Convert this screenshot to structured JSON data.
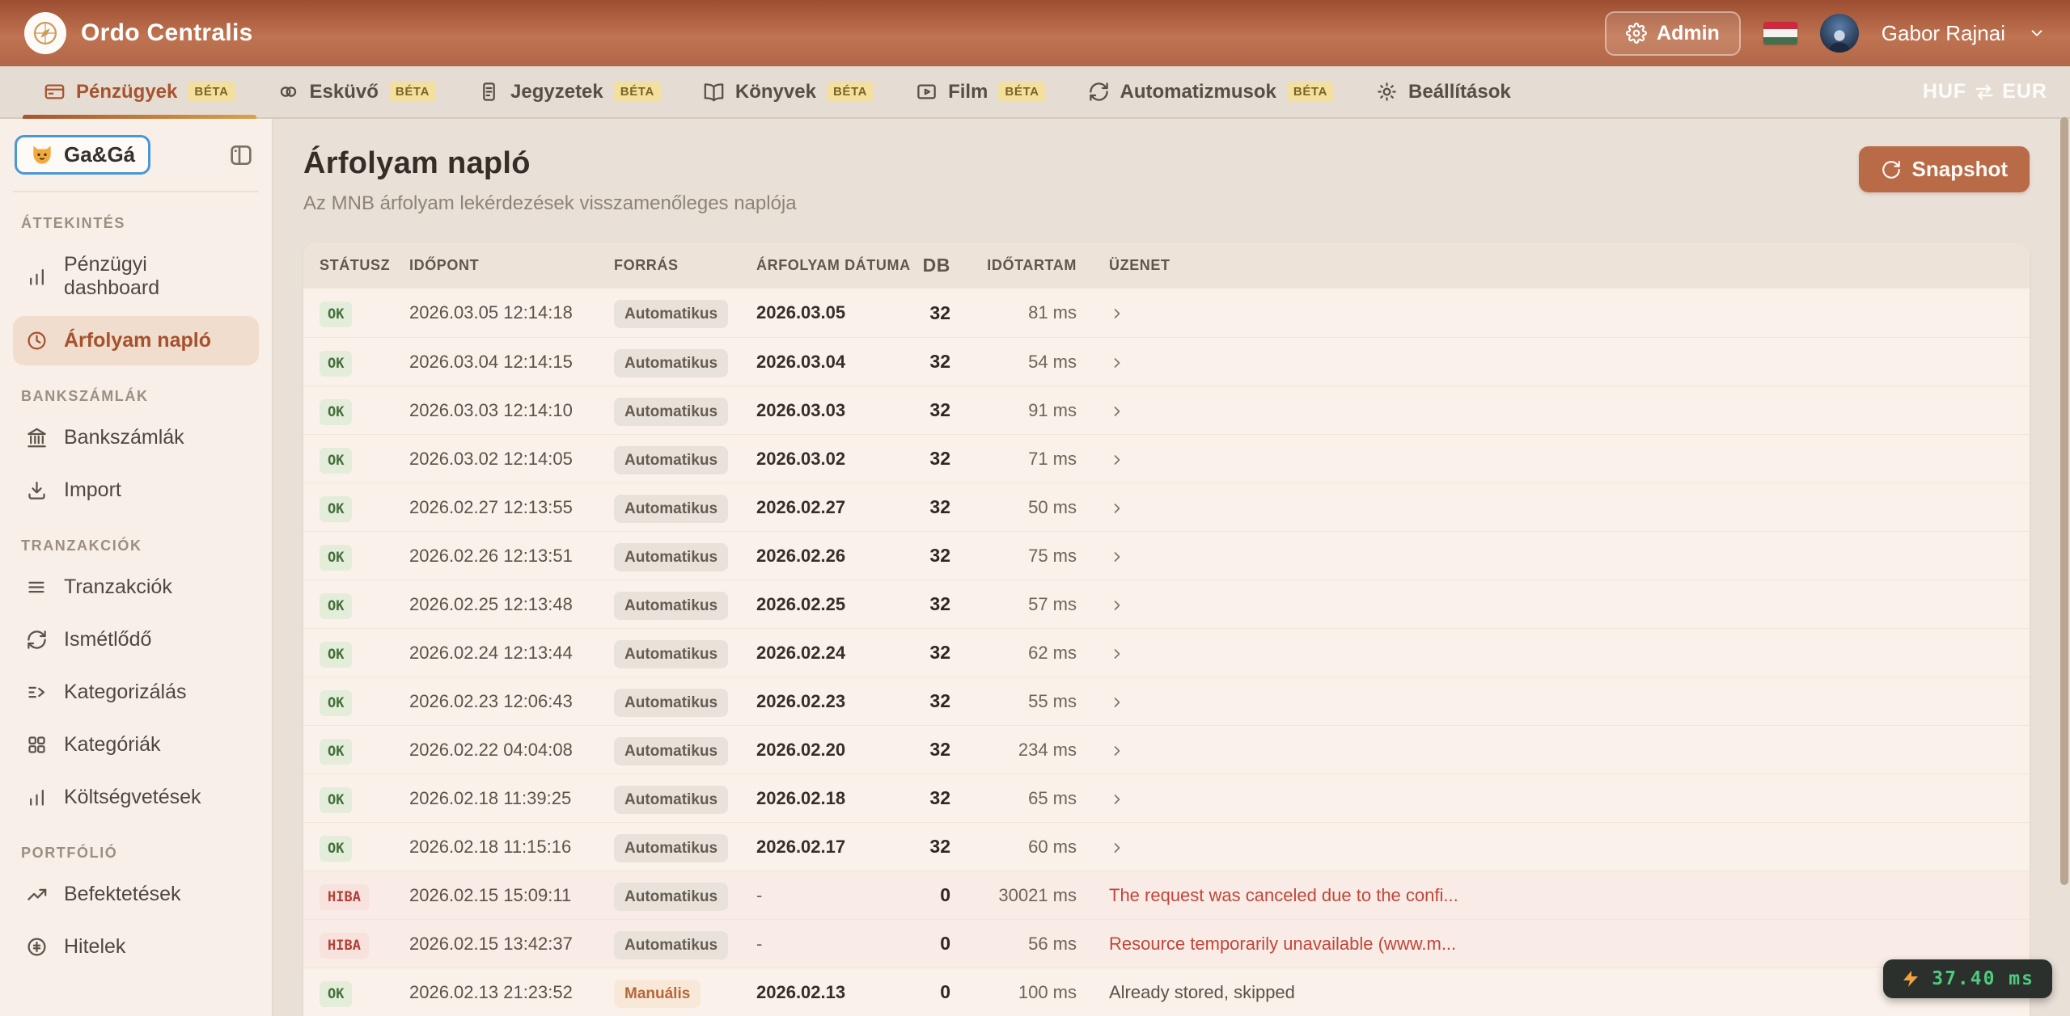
{
  "header": {
    "app_title": "Ordo Centralis",
    "admin_label": "Admin",
    "user_name": "Gabor Rajnai"
  },
  "tabbar": {
    "tabs": [
      {
        "label": "Pénzügyek",
        "icon": "wallet-icon",
        "badge": "BÉTA",
        "active": true
      },
      {
        "label": "Esküvő",
        "icon": "rings-icon",
        "badge": "BÉTA",
        "active": false
      },
      {
        "label": "Jegyzetek",
        "icon": "note-icon",
        "badge": "BÉTA",
        "active": false
      },
      {
        "label": "Könyvek",
        "icon": "book-icon",
        "badge": "BÉTA",
        "active": false
      },
      {
        "label": "Film",
        "icon": "film-icon",
        "badge": "BÉTA",
        "active": false
      },
      {
        "label": "Automatizmusok",
        "icon": "sync-icon",
        "badge": "BÉTA",
        "active": false
      },
      {
        "label": "Beállítások",
        "icon": "brightness-icon",
        "badge": null,
        "active": false
      }
    ],
    "currency": {
      "from": "HUF",
      "to": "EUR"
    }
  },
  "sidebar": {
    "workspace": {
      "label": "Ga&Gá",
      "icon": "cat-icon"
    },
    "sections": [
      {
        "label": "ÁTTEKINTÉS",
        "items": [
          {
            "label": "Pénzügyi dashboard",
            "icon": "bar-chart-icon",
            "active": false
          },
          {
            "label": "Árfolyam napló",
            "icon": "clock-icon",
            "active": true
          }
        ]
      },
      {
        "label": "BANKSZÁMLÁK",
        "items": [
          {
            "label": "Bankszámlák",
            "icon": "bank-icon",
            "active": false
          },
          {
            "label": "Import",
            "icon": "download-icon",
            "active": false
          }
        ]
      },
      {
        "label": "TRANZAKCIÓK",
        "items": [
          {
            "label": "Tranzakciók",
            "icon": "list-icon",
            "active": false
          },
          {
            "label": "Ismétlődő",
            "icon": "repeat-icon",
            "active": false
          },
          {
            "label": "Kategorizálás",
            "icon": "categorize-icon",
            "active": false
          },
          {
            "label": "Kategóriák",
            "icon": "grid-icon",
            "active": false
          },
          {
            "label": "Költségvetések",
            "icon": "bar-chart-icon",
            "active": false
          }
        ]
      },
      {
        "label": "PORTFÓLIÓ",
        "items": [
          {
            "label": "Befektetések",
            "icon": "trending-up-icon",
            "active": false
          },
          {
            "label": "Hitelek",
            "icon": "coin-icon",
            "active": false
          }
        ]
      }
    ]
  },
  "main": {
    "title": "Árfolyam napló",
    "subtitle": "Az MNB árfolyam lekérdezések visszamenőleges naplója",
    "snapshot_label": "Snapshot",
    "table": {
      "columns": [
        "STÁTUSZ",
        "IDŐPONT",
        "FORRÁS",
        "ÁRFOLYAM DÁTUMA",
        "DB",
        "IDŐTARTAM",
        "ÜZENET"
      ],
      "rows": [
        {
          "status": "OK",
          "idopont": "2026.03.05 12:14:18",
          "forras": "Automatikus",
          "datum": "2026.03.05",
          "db": "32",
          "idotartam": "81 ms",
          "uzenet": ""
        },
        {
          "status": "OK",
          "idopont": "2026.03.04 12:14:15",
          "forras": "Automatikus",
          "datum": "2026.03.04",
          "db": "32",
          "idotartam": "54 ms",
          "uzenet": ""
        },
        {
          "status": "OK",
          "idopont": "2026.03.03 12:14:10",
          "forras": "Automatikus",
          "datum": "2026.03.03",
          "db": "32",
          "idotartam": "91 ms",
          "uzenet": ""
        },
        {
          "status": "OK",
          "idopont": "2026.03.02 12:14:05",
          "forras": "Automatikus",
          "datum": "2026.03.02",
          "db": "32",
          "idotartam": "71 ms",
          "uzenet": ""
        },
        {
          "status": "OK",
          "idopont": "2026.02.27 12:13:55",
          "forras": "Automatikus",
          "datum": "2026.02.27",
          "db": "32",
          "idotartam": "50 ms",
          "uzenet": ""
        },
        {
          "status": "OK",
          "idopont": "2026.02.26 12:13:51",
          "forras": "Automatikus",
          "datum": "2026.02.26",
          "db": "32",
          "idotartam": "75 ms",
          "uzenet": ""
        },
        {
          "status": "OK",
          "idopont": "2026.02.25 12:13:48",
          "forras": "Automatikus",
          "datum": "2026.02.25",
          "db": "32",
          "idotartam": "57 ms",
          "uzenet": ""
        },
        {
          "status": "OK",
          "idopont": "2026.02.24 12:13:44",
          "forras": "Automatikus",
          "datum": "2026.02.24",
          "db": "32",
          "idotartam": "62 ms",
          "uzenet": ""
        },
        {
          "status": "OK",
          "idopont": "2026.02.23 12:06:43",
          "forras": "Automatikus",
          "datum": "2026.02.23",
          "db": "32",
          "idotartam": "55 ms",
          "uzenet": ""
        },
        {
          "status": "OK",
          "idopont": "2026.02.22 04:04:08",
          "forras": "Automatikus",
          "datum": "2026.02.20",
          "db": "32",
          "idotartam": "234 ms",
          "uzenet": ""
        },
        {
          "status": "OK",
          "idopont": "2026.02.18 11:39:25",
          "forras": "Automatikus",
          "datum": "2026.02.18",
          "db": "32",
          "idotartam": "65 ms",
          "uzenet": ""
        },
        {
          "status": "OK",
          "idopont": "2026.02.18 11:15:16",
          "forras": "Automatikus",
          "datum": "2026.02.17",
          "db": "32",
          "idotartam": "60 ms",
          "uzenet": ""
        },
        {
          "status": "HIBA",
          "idopont": "2026.02.15 15:09:11",
          "forras": "Automatikus",
          "datum": "-",
          "db": "0",
          "idotartam": "30021 ms",
          "uzenet": "The request was canceled due to the confi..."
        },
        {
          "status": "HIBA",
          "idopont": "2026.02.15 13:42:37",
          "forras": "Automatikus",
          "datum": "-",
          "db": "0",
          "idotartam": "56 ms",
          "uzenet": "Resource temporarily unavailable (www.m..."
        },
        {
          "status": "OK",
          "idopont": "2026.02.13 21:23:52",
          "forras": "Manuális",
          "datum": "2026.02.13",
          "db": "0",
          "idotartam": "100 ms",
          "uzenet": "Already stored, skipped"
        }
      ]
    }
  },
  "footer": {
    "performance": "37.40 ms"
  },
  "colors": {
    "accent": "#b96a47",
    "header_gradient_top": "#9d4e32",
    "ok_green": "#44703c",
    "error_red": "#b2403a",
    "perf_green": "#4ecb7d",
    "beta_yellow": "#f3e0a0"
  }
}
